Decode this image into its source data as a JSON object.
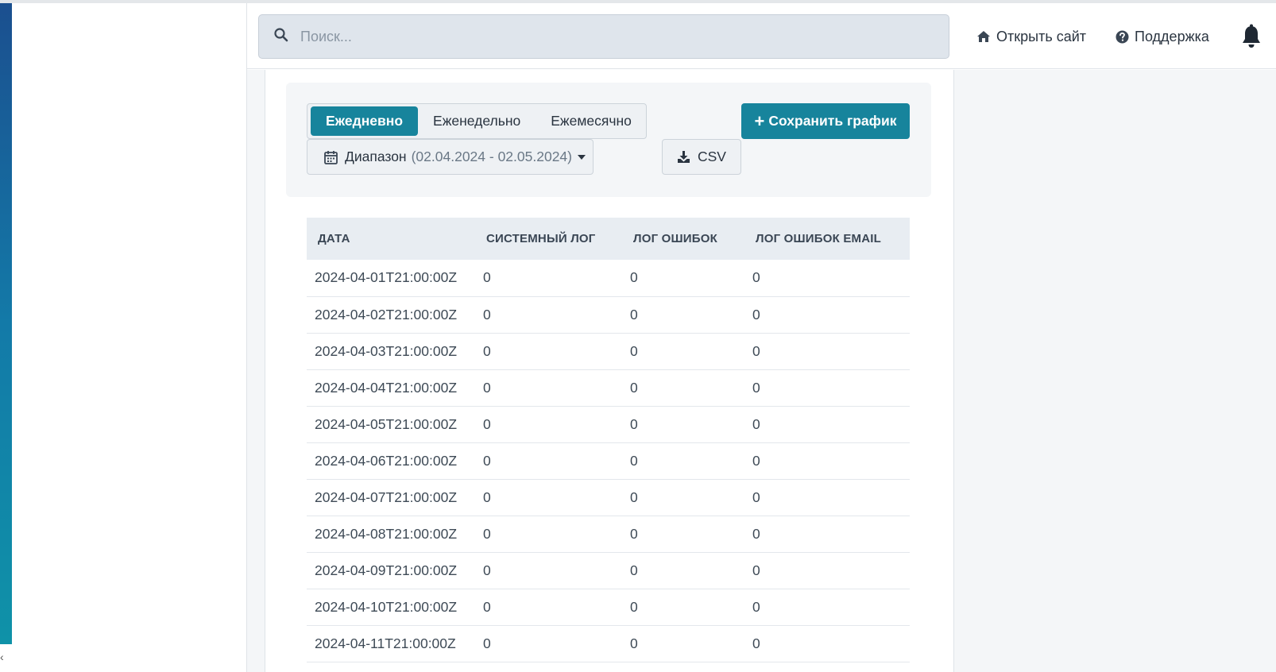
{
  "header": {
    "search_placeholder": "Поиск...",
    "open_site_label": "Открыть сайт",
    "support_label": "Поддержка"
  },
  "icons": {
    "search": "search-icon",
    "open_site": "home-icon",
    "support": "question-circle-icon",
    "notifications": "bell-icon",
    "range": "calendar-icon",
    "csv": "download-icon",
    "collapse": "chevron-left-icon"
  },
  "toolbar": {
    "periods": [
      {
        "label": "Ежедневно",
        "active": true
      },
      {
        "label": "Еженедельно",
        "active": false
      },
      {
        "label": "Ежемесячно",
        "active": false
      }
    ],
    "range_label": "Диапазон",
    "range_value": "(02.04.2024 - 02.05.2024)",
    "csv_label": "CSV",
    "save_label": "Сохранить график"
  },
  "colors": {
    "accent": "#17849c",
    "sidebar_gradient_top": "#1b4f8f",
    "sidebar_gradient_bottom": "#0f92a8"
  },
  "table": {
    "columns": [
      "ДАТА",
      "СИСТЕМНЫЙ ЛОГ",
      "ЛОГ ОШИБОК",
      "ЛОГ ОШИБОК EMAIL"
    ],
    "rows": [
      [
        "2024-04-01T21:00:00Z",
        "0",
        "0",
        "0"
      ],
      [
        "2024-04-02T21:00:00Z",
        "0",
        "0",
        "0"
      ],
      [
        "2024-04-03T21:00:00Z",
        "0",
        "0",
        "0"
      ],
      [
        "2024-04-04T21:00:00Z",
        "0",
        "0",
        "0"
      ],
      [
        "2024-04-05T21:00:00Z",
        "0",
        "0",
        "0"
      ],
      [
        "2024-04-06T21:00:00Z",
        "0",
        "0",
        "0"
      ],
      [
        "2024-04-07T21:00:00Z",
        "0",
        "0",
        "0"
      ],
      [
        "2024-04-08T21:00:00Z",
        "0",
        "0",
        "0"
      ],
      [
        "2024-04-09T21:00:00Z",
        "0",
        "0",
        "0"
      ],
      [
        "2024-04-10T21:00:00Z",
        "0",
        "0",
        "0"
      ],
      [
        "2024-04-11T21:00:00Z",
        "0",
        "0",
        "0"
      ]
    ]
  }
}
